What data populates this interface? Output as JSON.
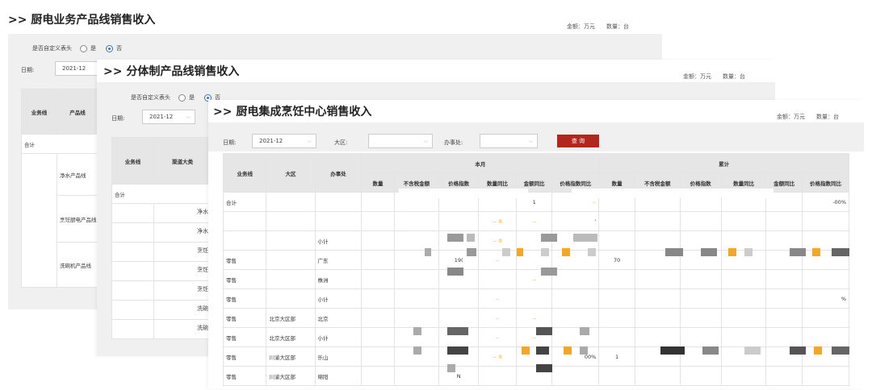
{
  "panel1": {
    "title": ">> 厨电业务产品线销售收入",
    "unit_amount": "金额：万元",
    "unit_qty": "数量：台",
    "custom_header_label": "是否自定义表头",
    "opt_yes": "是",
    "opt_no": "否",
    "date_label": "日期:",
    "date_value": "2021-12",
    "headers": [
      "业务线",
      "产品线"
    ],
    "total": "合计",
    "products": [
      "净水产品线",
      "烹饪厨电产品线",
      "洗碗机产品线"
    ]
  },
  "panel2": {
    "title": ">> 分体制产品线销售收入",
    "unit_amount": "金额：万元",
    "unit_qty": "数量：台",
    "custom_header_label": "是否自定义表头",
    "opt_yes": "是",
    "opt_no": "否",
    "date_label": "日期:",
    "date_value": "2021-12",
    "headers": [
      "业务线",
      "渠道大类"
    ],
    "total": "合计",
    "col3": [
      "净水",
      "净水",
      "烹饪",
      "烹饪",
      "烹饪",
      "洗碗",
      "洗碗"
    ]
  },
  "panel3": {
    "title": ">> 厨电集成烹饪中心销售收入",
    "unit_amount": "金额：万元",
    "unit_qty": "数量：台",
    "date_label": "日期:",
    "date_value": "2021-12",
    "region_label": "大区:",
    "office_label": "办事处:",
    "query_button": "查 询",
    "group_current": "本月",
    "group_cumulative": "累计",
    "row_headers": [
      "业务线",
      "大区",
      "办事处"
    ],
    "sub_headers": [
      "数量",
      "不含税金额",
      "价格指数",
      "数量同比",
      "金额同比",
      "价格指数同比",
      "数量",
      "不含税金额",
      "价格指数",
      "数量同比",
      "金额同比",
      "价格指数同比"
    ],
    "rows": [
      {
        "c": [
          "合计",
          "",
          ""
        ],
        "v": [
          "",
          "",
          "",
          "",
          "1",
          "--",
          "",
          "",
          "",
          "",
          "",
          "-00%"
        ]
      },
      {
        "c": [
          "",
          "",
          ""
        ],
        "v": [
          "",
          "",
          "",
          "--  0",
          "--",
          "'",
          "",
          "",
          "",
          "",
          "",
          ""
        ]
      },
      {
        "c": [
          "",
          "",
          "小计"
        ],
        "v": [
          "",
          "",
          "",
          "--  0",
          "",
          "",
          "",
          "",
          "",
          "",
          "",
          ""
        ]
      },
      {
        "c": [
          "零售",
          "",
          "广东"
        ],
        "v": [
          "",
          "",
          "19(",
          "--",
          "",
          "",
          "70",
          "",
          "",
          "",
          "",
          ""
        ]
      },
      {
        "c": [
          "零售",
          "",
          "株洲"
        ],
        "v": [
          "",
          "",
          "",
          "",
          "--",
          "",
          "",
          "",
          "",
          "",
          "",
          ""
        ]
      },
      {
        "c": [
          "零售",
          "",
          "小计"
        ],
        "v": [
          "",
          "",
          "",
          "--",
          "",
          "",
          "",
          "",
          "",
          "",
          "",
          "%"
        ]
      },
      {
        "c": [
          "零售",
          "北京大区部",
          "北京"
        ],
        "v": [
          "",
          "",
          "",
          "--",
          "--",
          "",
          "",
          "",
          "",
          "",
          "",
          ""
        ]
      },
      {
        "c": [
          "零售",
          "北京大区部",
          "小计"
        ],
        "v": [
          "",
          "",
          "",
          "--",
          "--",
          "",
          "",
          "",
          "",
          "",
          "",
          ""
        ]
      },
      {
        "c": [
          "零售",
          "川渝大区部",
          "乐山"
        ],
        "v": [
          "",
          "",
          "",
          "--  0",
          "",
          "00%",
          "1",
          "",
          "",
          "",
          "",
          ""
        ]
      },
      {
        "c": [
          "零售",
          "川渝大区部",
          "绵阳"
        ],
        "v": [
          "",
          "",
          "N",
          "",
          "",
          "",
          "",
          "",
          "",
          "",
          "",
          ""
        ]
      }
    ]
  }
}
